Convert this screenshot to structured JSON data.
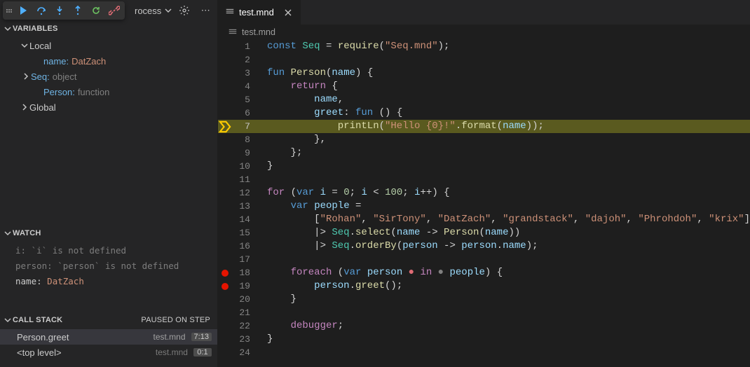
{
  "config_dropdown": {
    "label": "rocess"
  },
  "sections": {
    "variables": {
      "title": "VARIABLES"
    },
    "watch": {
      "title": "WATCH"
    },
    "callstack": {
      "title": "CALL STACK",
      "status": "PAUSED ON STEP"
    }
  },
  "variables": {
    "scopes": [
      {
        "name": "Local",
        "expanded": true,
        "items": [
          {
            "label": "name:",
            "value": "DatZach",
            "kind": "string"
          },
          {
            "label": "Seq:",
            "value": "object",
            "kind": "type",
            "expandable": true
          },
          {
            "label": "Person:",
            "value": "function",
            "kind": "type"
          }
        ]
      },
      {
        "name": "Global",
        "expanded": false
      }
    ]
  },
  "watch": [
    {
      "expr": "i:",
      "result": "`i` is not defined",
      "kind": "error"
    },
    {
      "expr": "person:",
      "result": "`person` is not defined",
      "kind": "error"
    },
    {
      "expr": "name:",
      "result": "DatZach",
      "kind": "string"
    }
  ],
  "callstack": [
    {
      "name": "Person.greet",
      "file": "test.mnd",
      "pos": "7:13",
      "selected": true
    },
    {
      "name": "<top level>",
      "file": "test.mnd",
      "pos": "0:1",
      "selected": false
    }
  ],
  "tab": {
    "filename": "test.mnd"
  },
  "breadcrumb": {
    "filename": "test.mnd"
  },
  "editor": {
    "current_line": 7,
    "breakpoints": [
      18,
      19
    ],
    "lines": [
      {
        "n": 1,
        "tokens": [
          [
            "kw2",
            "const"
          ],
          [
            "op",
            " "
          ],
          [
            "cls",
            "Seq"
          ],
          [
            "op",
            " = "
          ],
          [
            "fn",
            "require"
          ],
          [
            "op",
            "("
          ],
          [
            "str",
            "\"Seq.mnd\""
          ],
          [
            "op",
            ");"
          ]
        ]
      },
      {
        "n": 2,
        "tokens": []
      },
      {
        "n": 3,
        "tokens": [
          [
            "kw2",
            "fun"
          ],
          [
            "op",
            " "
          ],
          [
            "fn",
            "Person"
          ],
          [
            "op",
            "("
          ],
          [
            "id",
            "name"
          ],
          [
            "op",
            ") {"
          ]
        ]
      },
      {
        "n": 4,
        "tokens": [
          [
            "op",
            "    "
          ],
          [
            "kw",
            "return"
          ],
          [
            "op",
            " {"
          ]
        ]
      },
      {
        "n": 5,
        "tokens": [
          [
            "op",
            "        "
          ],
          [
            "id",
            "name"
          ],
          [
            "op",
            ","
          ]
        ]
      },
      {
        "n": 6,
        "tokens": [
          [
            "op",
            "        "
          ],
          [
            "id",
            "greet"
          ],
          [
            "op",
            ": "
          ],
          [
            "kw2",
            "fun"
          ],
          [
            "op",
            " () {"
          ]
        ]
      },
      {
        "n": 7,
        "tokens": [
          [
            "op",
            "            "
          ],
          [
            "fn",
            "printLn"
          ],
          [
            "op",
            "("
          ],
          [
            "str",
            "\"Hello {0}!\""
          ],
          [
            "op",
            "."
          ],
          [
            "fn",
            "format"
          ],
          [
            "op",
            "("
          ],
          [
            "id",
            "name"
          ],
          [
            "op",
            "));"
          ]
        ]
      },
      {
        "n": 8,
        "tokens": [
          [
            "op",
            "        },"
          ]
        ]
      },
      {
        "n": 9,
        "tokens": [
          [
            "op",
            "    };"
          ]
        ]
      },
      {
        "n": 10,
        "tokens": [
          [
            "op",
            "}"
          ]
        ]
      },
      {
        "n": 11,
        "tokens": []
      },
      {
        "n": 12,
        "tokens": [
          [
            "kw",
            "for"
          ],
          [
            "op",
            " ("
          ],
          [
            "kw2",
            "var"
          ],
          [
            "op",
            " "
          ],
          [
            "id",
            "i"
          ],
          [
            "op",
            " = "
          ],
          [
            "num",
            "0"
          ],
          [
            "op",
            "; "
          ],
          [
            "id",
            "i"
          ],
          [
            "op",
            " < "
          ],
          [
            "num",
            "100"
          ],
          [
            "op",
            "; "
          ],
          [
            "id",
            "i"
          ],
          [
            "op",
            "++) {"
          ]
        ]
      },
      {
        "n": 13,
        "tokens": [
          [
            "op",
            "    "
          ],
          [
            "kw2",
            "var"
          ],
          [
            "op",
            " "
          ],
          [
            "id",
            "people"
          ],
          [
            "op",
            " ="
          ]
        ]
      },
      {
        "n": 14,
        "tokens": [
          [
            "op",
            "        ["
          ],
          [
            "str",
            "\"Rohan\""
          ],
          [
            "op",
            ", "
          ],
          [
            "str",
            "\"SirTony\""
          ],
          [
            "op",
            ", "
          ],
          [
            "str",
            "\"DatZach\""
          ],
          [
            "op",
            ", "
          ],
          [
            "str",
            "\"grandstack\""
          ],
          [
            "op",
            ", "
          ],
          [
            "str",
            "\"dajoh\""
          ],
          [
            "op",
            ", "
          ],
          [
            "str",
            "\"Phrohdoh\""
          ],
          [
            "op",
            ", "
          ],
          [
            "str",
            "\"krix\""
          ],
          [
            "op",
            "]"
          ]
        ]
      },
      {
        "n": 15,
        "tokens": [
          [
            "op",
            "        |> "
          ],
          [
            "cls",
            "Seq"
          ],
          [
            "op",
            "."
          ],
          [
            "fn",
            "select"
          ],
          [
            "op",
            "("
          ],
          [
            "id",
            "name"
          ],
          [
            "op",
            " -> "
          ],
          [
            "fn",
            "Person"
          ],
          [
            "op",
            "("
          ],
          [
            "id",
            "name"
          ],
          [
            "op",
            "))"
          ]
        ]
      },
      {
        "n": 16,
        "tokens": [
          [
            "op",
            "        |> "
          ],
          [
            "cls",
            "Seq"
          ],
          [
            "op",
            "."
          ],
          [
            "fn",
            "orderBy"
          ],
          [
            "op",
            "("
          ],
          [
            "id",
            "person"
          ],
          [
            "op",
            " -> "
          ],
          [
            "id",
            "person"
          ],
          [
            "op",
            "."
          ],
          [
            "id",
            "name"
          ],
          [
            "op",
            ");"
          ]
        ]
      },
      {
        "n": 17,
        "tokens": []
      },
      {
        "n": 18,
        "tokens": [
          [
            "op",
            "    "
          ],
          [
            "kw",
            "foreach"
          ],
          [
            "op",
            " ("
          ],
          [
            "kw2",
            "var"
          ],
          [
            "op",
            " "
          ],
          [
            "id",
            "person"
          ],
          [
            "op",
            " "
          ],
          [
            "dot-red",
            "●"
          ],
          [
            "op",
            " "
          ],
          [
            "kw",
            "in"
          ],
          [
            "op",
            " "
          ],
          [
            "dot-grey",
            "●"
          ],
          [
            "op",
            " "
          ],
          [
            "id",
            "people"
          ],
          [
            "op",
            ") {"
          ]
        ]
      },
      {
        "n": 19,
        "tokens": [
          [
            "op",
            "        "
          ],
          [
            "id",
            "person"
          ],
          [
            "op",
            "."
          ],
          [
            "fn",
            "greet"
          ],
          [
            "op",
            "();"
          ]
        ]
      },
      {
        "n": 20,
        "tokens": [
          [
            "op",
            "    }"
          ]
        ]
      },
      {
        "n": 21,
        "tokens": []
      },
      {
        "n": 22,
        "tokens": [
          [
            "op",
            "    "
          ],
          [
            "kw",
            "debugger"
          ],
          [
            "op",
            ";"
          ]
        ]
      },
      {
        "n": 23,
        "tokens": [
          [
            "op",
            "}"
          ]
        ]
      },
      {
        "n": 24,
        "tokens": []
      }
    ]
  }
}
